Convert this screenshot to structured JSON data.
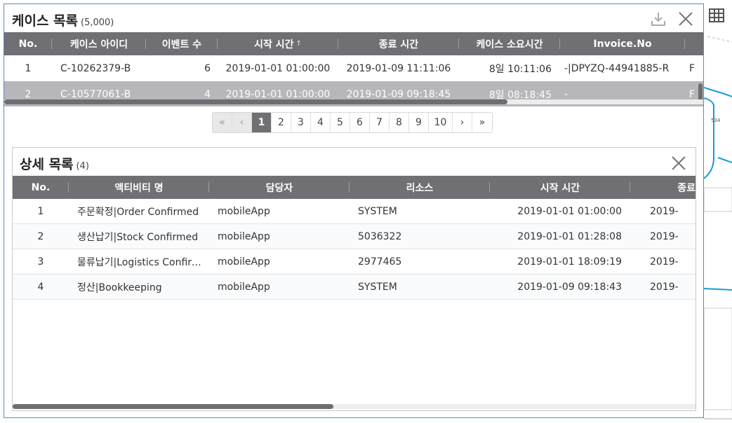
{
  "case_list": {
    "title": "케이스 목록",
    "count": "(5,000)",
    "columns": [
      "No.",
      "케이스 아이디",
      "이벤트 수",
      "시작 시간",
      "종료 시간",
      "케이스 소요시간",
      "Invoice.No"
    ],
    "sort_indicator": "↑",
    "rows": [
      {
        "no": "1",
        "case_id": "C-10262379-B",
        "events": "6",
        "start": "2019-01-01 01:00:00",
        "end": "2019-01-09 11:11:06",
        "duration": "8일 10:11:06",
        "invoice": "-|DPYZQ-44941885-R",
        "extra": "F"
      },
      {
        "no": "2",
        "case_id": "C-10577061-B",
        "events": "4",
        "start": "2019-01-01 01:00:00",
        "end": "2019-01-09 09:18:45",
        "duration": "8일 08:18:45",
        "invoice": "-",
        "extra": "F"
      }
    ],
    "selected_row_index": 1,
    "horizontal_scroll_fraction": 0.72
  },
  "pagination": {
    "first": "«",
    "prev": "‹",
    "pages": [
      "1",
      "2",
      "3",
      "4",
      "5",
      "6",
      "7",
      "8",
      "9",
      "10"
    ],
    "active_page": "1",
    "next": "›",
    "last": "»"
  },
  "detail_list": {
    "title": "상세 목록",
    "count": "(4)",
    "columns": [
      "No.",
      "액티비티 명",
      "담당자",
      "리소스",
      "시작 시간",
      "종료"
    ],
    "rows": [
      {
        "no": "1",
        "activity": "주문확정|Order Confirmed",
        "owner": "mobileApp",
        "resource": "SYSTEM",
        "start": "2019-01-01 01:00:00",
        "end": "2019-"
      },
      {
        "no": "2",
        "activity": "생산납기|Stock Confirmed",
        "owner": "mobileApp",
        "resource": "5036322",
        "start": "2019-01-01 01:28:08",
        "end": "2019-"
      },
      {
        "no": "3",
        "activity": "물류납기|Logistics Confirm...",
        "owner": "mobileApp",
        "resource": "2977465",
        "start": "2019-01-01 18:09:19",
        "end": "2019-"
      },
      {
        "no": "4",
        "activity": "정산|Bookkeeping",
        "owner": "mobileApp",
        "resource": "SYSTEM",
        "start": "2019-01-09 09:18:43",
        "end": "2019-"
      }
    ],
    "horizontal_scroll_fraction": 0.47
  },
  "background": {
    "graph_edge_label": "534"
  },
  "icons": {
    "grid": "grid-icon",
    "download": "download-icon",
    "close": "close-icon"
  },
  "colors": {
    "header_bg": "#6f6f74",
    "selected_row_bg": "#b6b6bb",
    "panel_border": "#4a90c2",
    "graph_edge": "#1a9ad6"
  }
}
